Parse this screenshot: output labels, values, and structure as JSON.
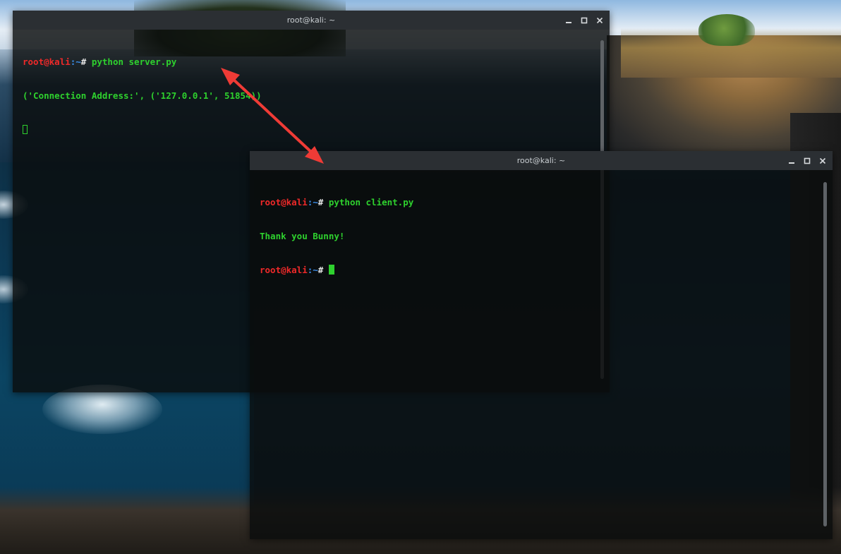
{
  "desktop": {
    "wallpaper": "coastal-cliff-photo"
  },
  "windows": {
    "server": {
      "title": "root@kali: ~",
      "prompt": {
        "user": "root@kali",
        "sep": ":",
        "path": "~",
        "hash": "#"
      },
      "command": " python server.py",
      "output": "('Connection Address:', ('127.0.0.1', 51854))"
    },
    "client": {
      "title": "root@kali: ~",
      "prompt": {
        "user": "root@kali",
        "sep": ":",
        "path": "~",
        "hash": "#"
      },
      "command": " python client.py",
      "output": "Thank you Bunny!"
    }
  },
  "controls": {
    "minimize": "minimize-icon",
    "maximize": "maximize-icon",
    "close": "close-icon"
  },
  "colors": {
    "prompt_user": "#ef2929",
    "prompt_path": "#3b8eea",
    "text_green": "#2ed12e",
    "titlebar": "#2b2f33",
    "arrow": "#ef3b36"
  }
}
